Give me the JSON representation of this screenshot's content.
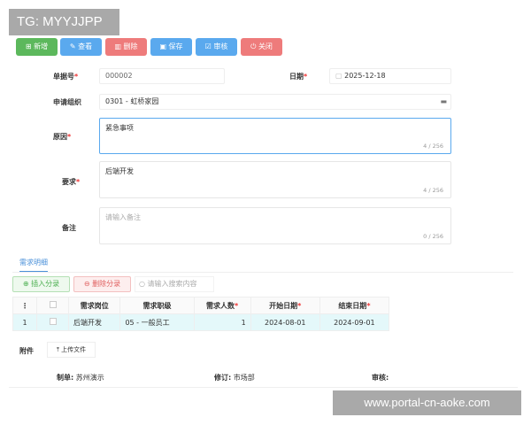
{
  "watermark_top": "TG: MYYJJPP",
  "watermark_bottom": "www.portal-cn-aoke.com",
  "toolbar": [
    {
      "label": "新增",
      "icon": "add-doc",
      "color": "#5cb85c"
    },
    {
      "label": "查看",
      "icon": "edit",
      "color": "#5aa9ee"
    },
    {
      "label": "删除",
      "icon": "trash",
      "color": "#ee7b7b"
    },
    {
      "label": "保存",
      "icon": "save",
      "color": "#5aa9ee"
    },
    {
      "label": "审核",
      "icon": "clipboard-check",
      "color": "#5aa9ee"
    },
    {
      "label": "关闭",
      "icon": "power",
      "color": "#ee7b7b"
    }
  ],
  "form": {
    "doc_no_label": "单据号",
    "doc_no": "000002",
    "date_label": "日期",
    "date": "2025-12-18",
    "org_label": "申请组织",
    "org": "0301 - 虹桥家园",
    "reason_label": "原因",
    "reason": "紧急事项",
    "reason_count": "4 / 256",
    "requirement_label": "要求",
    "requirement": "后端开发",
    "requirement_count": "4 / 256",
    "remark_label": "备注",
    "remark_placeholder": "请输入备注",
    "remark_count": "0 / 256"
  },
  "detail": {
    "tab": "需求明细",
    "insert": "插入分录",
    "delete": "删除分录",
    "search_placeholder": "请输入搜索内容",
    "columns": [
      "需求岗位",
      "需求职级",
      "需求人数",
      "开始日期",
      "结束日期"
    ],
    "rows": [
      {
        "no": "1",
        "position": "后端开发",
        "level": "05 - 一般员工",
        "count": "1",
        "start": "2024-08-01",
        "end": "2024-09-01"
      }
    ]
  },
  "attachment": {
    "label": "附件",
    "upload": "上传文件"
  },
  "footer": {
    "maker_label": "制单:",
    "maker": "苏州演示",
    "revise_label": "修订:",
    "revise": "市场部",
    "audit_label": "审核:"
  }
}
